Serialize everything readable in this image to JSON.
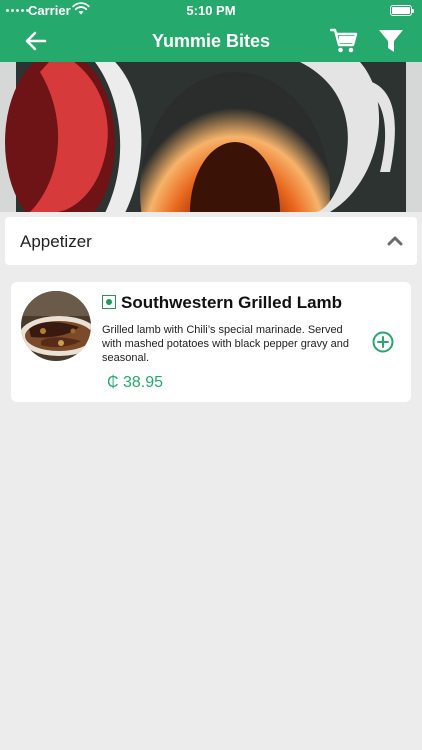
{
  "status_bar": {
    "carrier": "Carrier",
    "time": "5:10 PM"
  },
  "nav": {
    "title": "Yummie Bites",
    "back_icon": "arrow-left-icon",
    "cart_icon": "cart-icon",
    "filter_icon": "filter-icon"
  },
  "banner": {
    "image": "restaurant-logo-banner"
  },
  "category": {
    "name": "Appetizer",
    "expanded": true
  },
  "items": [
    {
      "title": "Southwestern Grilled Lamb",
      "description": "Grilled lamb with Chili’s special marinade. Served with mashed potatoes with black pepper gravy and seasonal.",
      "price": "₵ 38.95",
      "veg_indicator": true
    }
  ],
  "colors": {
    "brand": "#26a96c",
    "background": "#ececec"
  }
}
